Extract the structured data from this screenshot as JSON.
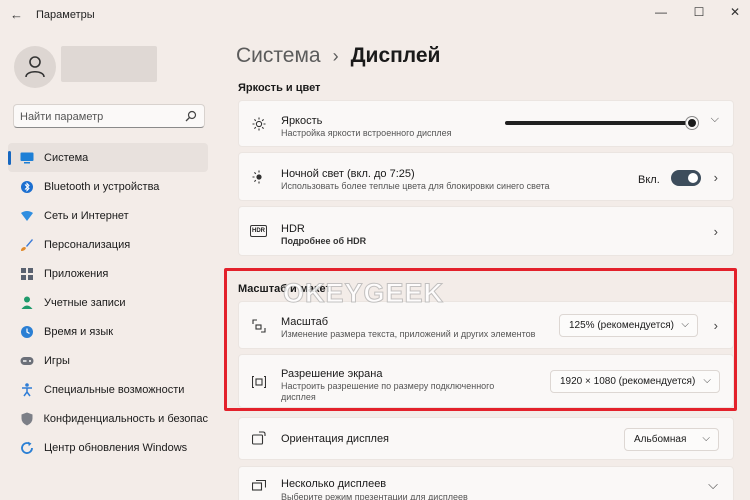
{
  "window": {
    "title": "Параметры",
    "back_icon": "arrow-left-icon",
    "minimize": "—",
    "maximize": "☐",
    "close": "✕"
  },
  "search": {
    "placeholder": "Найти параметр",
    "icon": "search-icon"
  },
  "sidebar": {
    "items": [
      {
        "label": "Система",
        "icon": "display-icon",
        "active": true
      },
      {
        "label": "Bluetooth и устройства",
        "icon": "bluetooth-icon"
      },
      {
        "label": "Сеть и Интернет",
        "icon": "wifi-icon"
      },
      {
        "label": "Персонализация",
        "icon": "brush-icon"
      },
      {
        "label": "Приложения",
        "icon": "apps-icon"
      },
      {
        "label": "Учетные записи",
        "icon": "person-icon"
      },
      {
        "label": "Время и язык",
        "icon": "globe-clock-icon"
      },
      {
        "label": "Игры",
        "icon": "gamepad-icon"
      },
      {
        "label": "Специальные возможности",
        "icon": "accessibility-icon"
      },
      {
        "label": "Конфиденциальность и безопас",
        "icon": "shield-icon"
      },
      {
        "label": "Центр обновления Windows",
        "icon": "update-icon"
      }
    ]
  },
  "breadcrumb": {
    "parent": "Система",
    "separator": "›",
    "current": "Дисплей"
  },
  "sections": {
    "brightness_color": "Яркость и цвет",
    "scale_layout": "Масштаб и макет"
  },
  "brightness": {
    "title": "Яркость",
    "subtitle": "Настройка яркости встроенного дисплея",
    "level": 1.0
  },
  "night_light": {
    "title": "Ночной свет (вкл. до 7:25)",
    "subtitle": "Использовать более теплые цвета для блокировки синего света",
    "state_label": "Вкл.",
    "on": true
  },
  "hdr": {
    "title": "HDR",
    "subtitle": "Подробнее об HDR",
    "icon_text": "HDR"
  },
  "scale": {
    "title": "Масштаб",
    "subtitle": "Изменение размера текста, приложений и других элементов",
    "value": "125% (рекомендуется)"
  },
  "resolution": {
    "title": "Разрешение экрана",
    "subtitle_line1": "Настроить  разрешение  по  размеру  подключенного",
    "subtitle_line2": "дисплея",
    "value": "1920 × 1080 (рекомендуется)"
  },
  "orientation": {
    "title": "Ориентация дисплея",
    "value": "Альбомная"
  },
  "multiple_displays": {
    "title": "Несколько дисплеев",
    "subtitle": "Выберите режим презентации для дисплеев"
  },
  "watermark": "OKEYGEEK",
  "colors": {
    "accent": "#1767c0",
    "highlight": "#e3212b",
    "background": "#f3ece8"
  }
}
